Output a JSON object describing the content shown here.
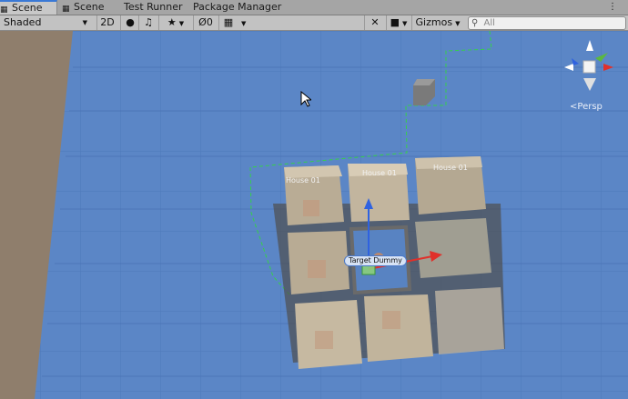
{
  "tabs": [
    {
      "label": "Scene",
      "icon": "grid-icon",
      "active": true
    },
    {
      "label": "Scene",
      "icon": "grid-icon",
      "active": false
    },
    {
      "label": "Test Runner",
      "icon": "",
      "active": false
    },
    {
      "label": "Package Manager",
      "icon": "",
      "active": false
    }
  ],
  "toolbar": {
    "draw_mode": "Shaded",
    "mode_2d": "2D",
    "hidden_count": "0",
    "gizmos_label": "Gizmos",
    "search_placeholder": "All"
  },
  "scene": {
    "view_label": "Persp",
    "selected_object": "Target Dummy",
    "house_labels": [
      "House 01",
      "House 01",
      "House 01"
    ],
    "axis_colors": {
      "x": "#e0302a",
      "y": "#5bb840",
      "z": "#2f62e0"
    }
  }
}
